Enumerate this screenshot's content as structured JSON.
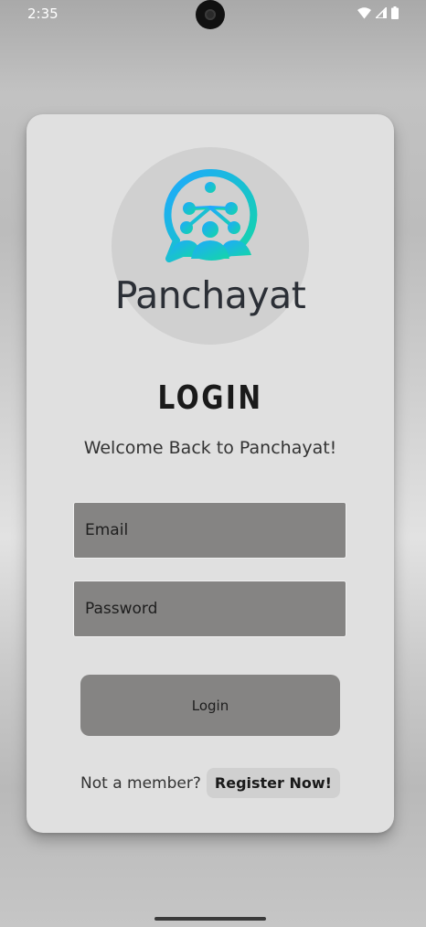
{
  "status_bar": {
    "time": "2:35",
    "icons": [
      "wifi-icon",
      "signal-icon",
      "battery-icon"
    ]
  },
  "brand": {
    "name": "Panchayat",
    "logo_icon": "panchayat-logo-icon",
    "gradient_start": "#1fb0ff",
    "gradient_end": "#14d6a8"
  },
  "login": {
    "title": "LOGIN",
    "welcome": "Welcome Back to Panchayat!",
    "email_placeholder": "Email",
    "password_placeholder": "Password",
    "button_label": "Login",
    "not_member_text": "Not a member?",
    "register_label": "Register Now!"
  },
  "colors": {
    "card_background": "#e0e0e0",
    "field_background": "#858483",
    "logo_circle": "#d0d0d0"
  }
}
